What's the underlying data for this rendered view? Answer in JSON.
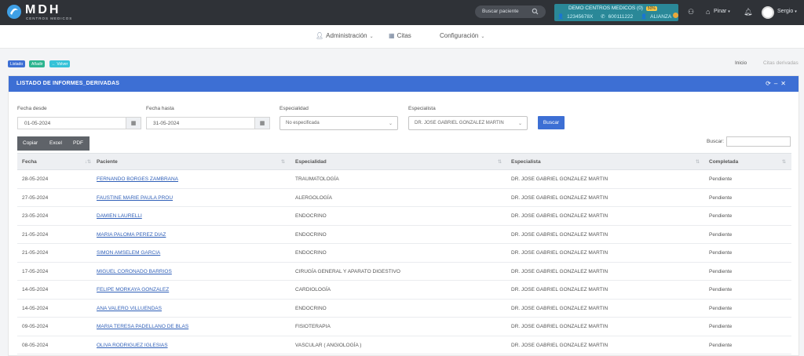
{
  "navbar": {
    "brand": "MDH",
    "brand_sub": "CENTROS MEDICOS",
    "search_placeholder": "Buscar paciente",
    "center": {
      "name": "DEMO CENTROS MEDICOS (0)",
      "percent": "50%",
      "id": "12345678X",
      "phone": "600111222",
      "plan": "ALIANZA"
    },
    "location": "Pinar",
    "user": "Sergio"
  },
  "menu": {
    "admin": "Administración",
    "citas": "Citas",
    "config": "Configuración"
  },
  "actions": {
    "listado": "Listado",
    "anadir": "Añadir",
    "volver": "Volver"
  },
  "breadcrumb": {
    "home": "Inicio",
    "current": "Citas derivadas"
  },
  "panel": {
    "title": "LISTADO DE INFORMES_DERIVADAS",
    "tools": "⟳ – ✕"
  },
  "filters": {
    "fecha_desde_label": "Fecha desde",
    "fecha_desde": "01-05-2024",
    "fecha_hasta_label": "Fecha hasta",
    "fecha_hasta": "31-05-2024",
    "especialidad_label": "Especialidad",
    "especialidad": "No especificada",
    "especialista_label": "Especialista",
    "especialista": "DR. JOSE GABRIEL GONZALEZ MARTIN",
    "buscar": "Buscar"
  },
  "export": {
    "copiar": "Copiar",
    "excel": "Excel",
    "pdf": "PDF",
    "search_label": "Buscar:"
  },
  "table": {
    "headers": [
      "Fecha",
      "Paciente",
      "Especialidad",
      "Especialista",
      "Completada"
    ],
    "rows": [
      {
        "fecha": "28-05-2024",
        "paciente": "FERNANDO BORGES ZAMBRANA",
        "especialidad": "TRAUMATOLOGÍA",
        "especialista": "DR. JOSE GABRIEL GONZALEZ MARTIN",
        "completada": "Pendiente"
      },
      {
        "fecha": "27-05-2024",
        "paciente": "FAUSTINE MARIE PAULA PROU",
        "especialidad": "ALERGOLOGÍA",
        "especialista": "DR. JOSE GABRIEL GONZALEZ MARTIN",
        "completada": "Pendiente"
      },
      {
        "fecha": "23-05-2024",
        "paciente": "DAMIEN LAURELLI",
        "especialidad": "ENDOCRINO",
        "especialista": "DR. JOSE GABRIEL GONZALEZ MARTIN",
        "completada": "Pendiente"
      },
      {
        "fecha": "21-05-2024",
        "paciente": "MARIA PALOMA PEREZ DIAZ",
        "especialidad": "ENDOCRINO",
        "especialista": "DR. JOSE GABRIEL GONZALEZ MARTIN",
        "completada": "Pendiente"
      },
      {
        "fecha": "21-05-2024",
        "paciente": "SIMON AMSELEM GARCIA",
        "especialidad": "ENDOCRINO",
        "especialista": "DR. JOSE GABRIEL GONZALEZ MARTIN",
        "completada": "Pendiente"
      },
      {
        "fecha": "17-05-2024",
        "paciente": "MIGUEL CORONADO BARRIOS",
        "especialidad": "CIRUGÍA GENERAL Y APARATO DIGESTIVO",
        "especialista": "DR. JOSE GABRIEL GONZALEZ MARTIN",
        "completada": "Pendiente"
      },
      {
        "fecha": "14-05-2024",
        "paciente": "FELIPE MORKAYA GONZALEZ",
        "especialidad": "CARDIOLOGÍA",
        "especialista": "DR. JOSE GABRIEL GONZALEZ MARTIN",
        "completada": "Pendiente"
      },
      {
        "fecha": "14-05-2024",
        "paciente": "ANA VALERO VILLUENDAS",
        "especialidad": "ENDOCRINO",
        "especialista": "DR. JOSE GABRIEL GONZALEZ MARTIN",
        "completada": "Pendiente"
      },
      {
        "fecha": "09-05-2024",
        "paciente": "MARIA TERESA PADELLANO DE BLAS",
        "especialidad": "FISIOTERAPIA",
        "especialista": "DR. JOSE GABRIEL GONZALEZ MARTIN",
        "completada": "Pendiente"
      },
      {
        "fecha": "08-05-2024",
        "paciente": "OLIVA RODRIGUEZ IGLESIAS",
        "especialidad": "VASCULAR ( ANGIOLOGÍA )",
        "especialista": "DR. JOSE GABRIEL GONZALEZ MARTIN",
        "completada": "Pendiente"
      }
    ]
  },
  "colors": {
    "navbar": "#2f3237",
    "accent": "#3d6fd4",
    "center_box": "#2a8898",
    "listado_btn": "#3d6fd4",
    "anadir_btn": "#2db48f",
    "volver_btn": "#35c2d8"
  }
}
